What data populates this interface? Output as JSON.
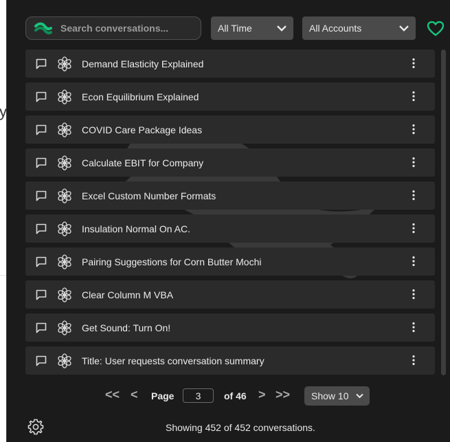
{
  "search": {
    "placeholder": "Search conversations..."
  },
  "filters": {
    "time": "All Time",
    "accounts": "All Accounts"
  },
  "conversations": [
    {
      "title": "Demand Elasticity Explained"
    },
    {
      "title": "Econ Equilibrium Explained"
    },
    {
      "title": "COVID Care Package Ideas"
    },
    {
      "title": "Calculate EBIT for Company"
    },
    {
      "title": "Excel Custom Number Formats"
    },
    {
      "title": "Insulation Normal On AC."
    },
    {
      "title": "Pairing Suggestions for Corn Butter Mochi"
    },
    {
      "title": "Clear Column M VBA"
    },
    {
      "title": "Get Sound: Turn On!"
    },
    {
      "title": "Title: User requests conversation summary"
    }
  ],
  "pagination": {
    "first": "<<",
    "prev": "<",
    "page_label": "Page",
    "current_page": "3",
    "of_label": "of 46",
    "next": ">",
    "last": ">>",
    "show_label": "Show 10"
  },
  "footer": {
    "status": "Showing 452 of 452 conversations."
  },
  "colors": {
    "panel_bg": "#1b1b1b",
    "row_bg": "#2b2b2b",
    "accent_green": "#19c37d",
    "select_bg": "#4a4a4a"
  },
  "icons": {
    "search_logo": "extension-logo-icon",
    "heart": "heart-icon",
    "row_chat": "chat-bubble-icon",
    "row_model": "openai-icon",
    "row_menu": "kebab-menu-icon",
    "settings": "gear-icon",
    "dropdown": "chevron-down-icon"
  }
}
